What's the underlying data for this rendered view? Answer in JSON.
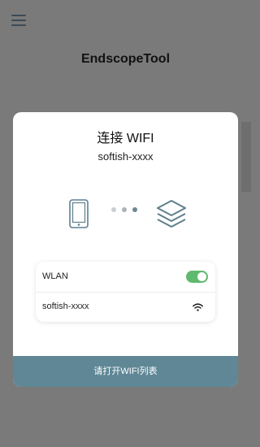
{
  "app": {
    "title": "EndscopeTool"
  },
  "dialog": {
    "title": "连接 WIFI",
    "ssid": "softish-xxxx",
    "wlan_label": "WLAN",
    "wlan_enabled": true,
    "network_name": "softish-xxxx",
    "open_button": "请打开WIFI列表"
  },
  "colors": {
    "accent": "#5f8796",
    "toggle_on": "#5fb96e",
    "icon": "#5f7f8d"
  },
  "icons": [
    "menu-icon",
    "phone-icon",
    "layers-icon",
    "wifi-icon"
  ]
}
